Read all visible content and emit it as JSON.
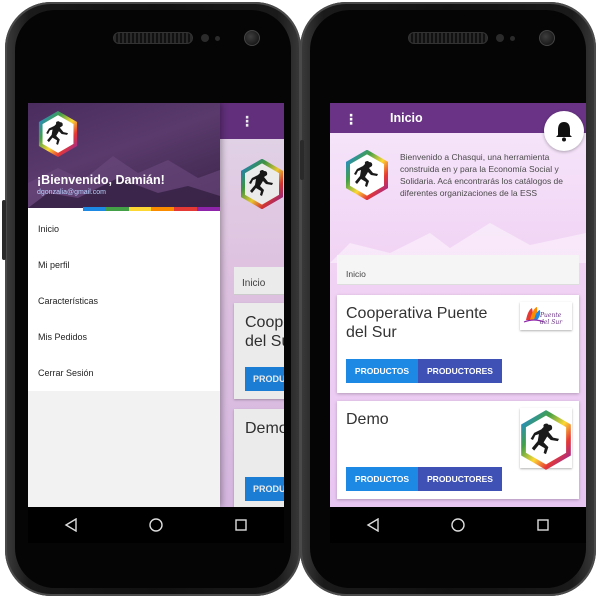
{
  "left_phone": {
    "drawer": {
      "welcome": "¡Bienvenido, Damián!",
      "email": "dgonzalia@gmail.com",
      "items": [
        {
          "label": "Inicio"
        },
        {
          "label": "Mi perfil"
        },
        {
          "label": "Características"
        },
        {
          "label": "Mis Pedidos"
        },
        {
          "label": "Cerrar Sesión"
        }
      ],
      "rainbow_colors": [
        "#1e88e5",
        "#43a047",
        "#fdd835",
        "#fb8c00",
        "#e53935",
        "#8e24aa"
      ]
    },
    "background": {
      "menu_icon": "⋮",
      "breadcrumb": "Inicio",
      "cards": [
        {
          "title": "Coope\ndel Su",
          "button": "PRODUC"
        },
        {
          "title": "Demo",
          "button": "PRODUC"
        }
      ]
    }
  },
  "right_phone": {
    "appbar": {
      "menu_icon": "⋮",
      "title": "Inicio",
      "notification_icon": "bell-icon"
    },
    "welcome_text": "Bienvenido a Chasqui, una herramienta construida en y para la Economía Social y Solidaria. Acá encontrarás los catálogos de diferentes organizaciones de la ESS",
    "breadcrumb": "Inicio",
    "cards": [
      {
        "title": "Cooperativa Puente del Sur",
        "logo_text": "Puente del Sur",
        "products_button": "PRODUCTOS",
        "producers_button": "PRODUCTORES"
      },
      {
        "title": "Demo",
        "products_button": "PRODUCTOS",
        "producers_button": "PRODUCTORES"
      }
    ]
  },
  "navbar": {
    "icons": [
      "back-icon",
      "home-icon",
      "recents-icon"
    ]
  },
  "colors": {
    "appbar": "#6a3386",
    "products_button": "#1e88e5",
    "producers_button": "#3f51b5"
  }
}
